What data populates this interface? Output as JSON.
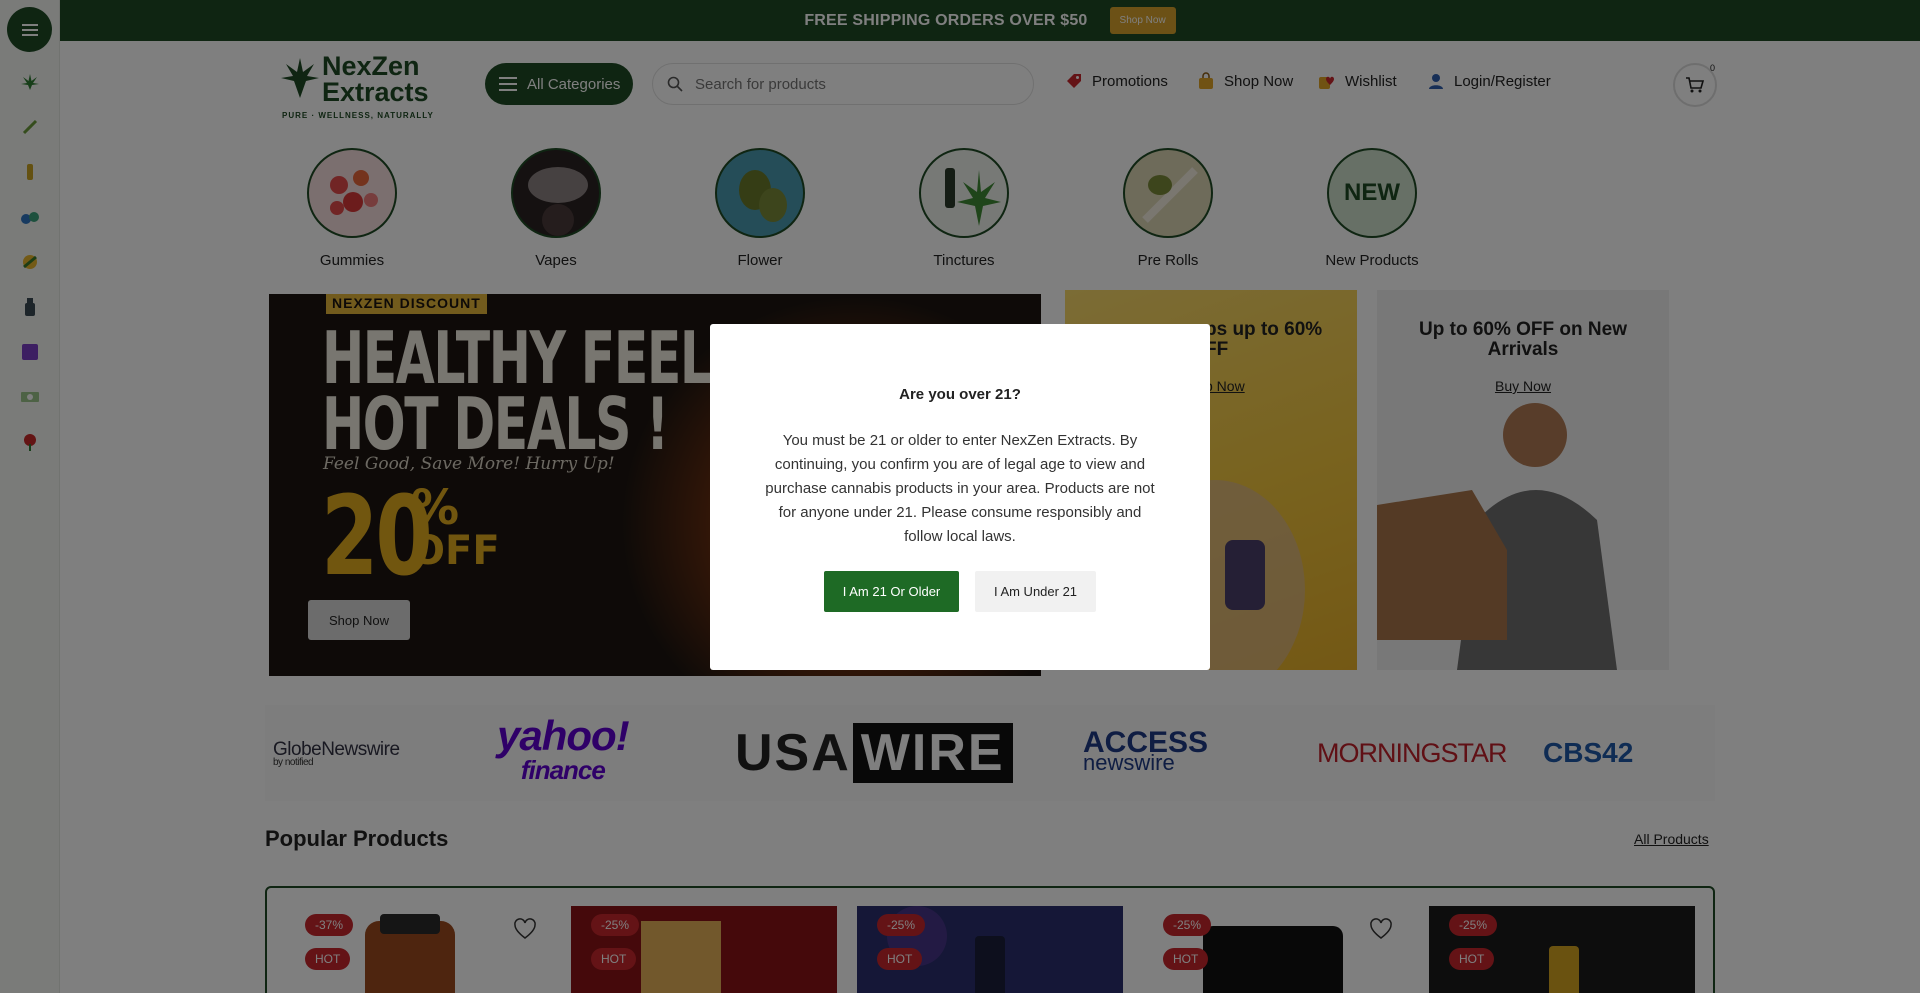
{
  "topbar": {
    "text": "FREE SHIPPING  ORDERS OVER $50",
    "button": "Shop Now"
  },
  "header": {
    "logo": {
      "line1": "NexZen",
      "line2": "Extracts",
      "tagline": "PURE · WELLNESS, NATURALLY"
    },
    "all_categories": "All Categories",
    "search_placeholder": "Search for products",
    "nav": {
      "promotions": "Promotions",
      "shop_now": "Shop Now",
      "wishlist": "Wishlist",
      "login": "Login/Register"
    },
    "cart_count": "0"
  },
  "rail": {
    "icons": [
      "cannabis-leaf-icon",
      "pen-icon",
      "vape-icon",
      "gummies-icon",
      "edibles-icon",
      "bottle-icon",
      "purple-box-icon",
      "cash-icon",
      "flower-icon"
    ]
  },
  "categories": [
    {
      "label": "Gummies",
      "color": "#e24b4b"
    },
    {
      "label": "Vapes",
      "color": "#3a2b2b"
    },
    {
      "label": "Flower",
      "color": "#4a9bb0"
    },
    {
      "label": "Tinctures",
      "color": "#e8efe6"
    },
    {
      "label": "Pre Rolls",
      "color": "#c9c29a"
    },
    {
      "label": "New Products",
      "new_text": "NEW",
      "color": "#cfe0cd"
    }
  ],
  "hero": {
    "tag": "NEXZEN DISCOUNT",
    "title_line1": "HEALTHY FEELS,",
    "title_line2": "HOT DEALS !",
    "subtitle": "Feel Good, Save More! Hurry Up!",
    "percent": "20",
    "percent_sign": "%",
    "off": "OFF",
    "button": "Shop Now"
  },
  "promos": [
    {
      "title_visible": "ps up to 60%",
      "title_line2": "FF",
      "link": "p Now"
    },
    {
      "title": "Up to 60% OFF on New Arrivals",
      "link": "Buy Now"
    }
  ],
  "press": {
    "globe": "GlobeNewswire",
    "globe_sub": "by notified",
    "yahoo": "yahoo!",
    "yahoo_sub": "finance",
    "usa": "USA",
    "usa_wire": "WIRE",
    "access": "ACCESS",
    "access_sub": "newswire",
    "morningstar": "MORNINGSTAR",
    "cbs": "CBS42"
  },
  "popular": {
    "title": "Popular Products",
    "all_link": "All Products",
    "cards": [
      {
        "discount": "-37%",
        "hot": "HOT",
        "bg": "#ffffff"
      },
      {
        "discount": "-25%",
        "hot": "HOT",
        "bg": "#8a1316"
      },
      {
        "discount": "-25%",
        "hot": "HOT",
        "bg": "#2a2f6e"
      },
      {
        "discount": "-25%",
        "hot": "HOT",
        "bg": "#ffffff"
      },
      {
        "discount": "-25%",
        "hot": "HOT",
        "bg": "#1a1a1a"
      }
    ]
  },
  "modal": {
    "title": "Are you over 21?",
    "body": "You must be 21 or older to enter NexZen Extracts. By continuing, you confirm you are of legal age to view and purchase cannabis products in your area. Products are not for anyone under 21. Please consume responsibly and follow local laws.",
    "yes": "I Am 21 Or Older",
    "no": "I Am Under 21"
  },
  "colors": {
    "brand": "#1e4a24",
    "accent": "#d9a32c",
    "sale": "#c8272d"
  }
}
